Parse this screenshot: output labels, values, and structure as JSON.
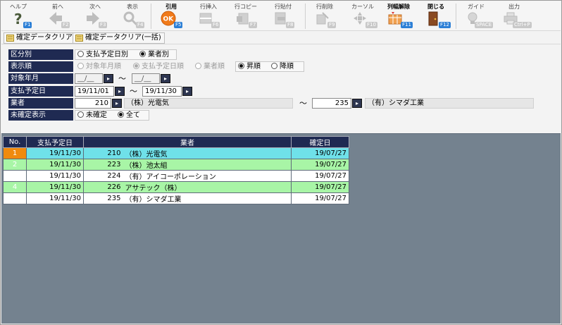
{
  "toolbar": {
    "buttons": [
      {
        "label": "ヘルプ",
        "fkey": "F1",
        "icon": "help-icon"
      },
      {
        "label": "前へ",
        "fkey": "F2",
        "icon": "arrow-left-icon"
      },
      {
        "label": "次へ",
        "fkey": "F3",
        "icon": "arrow-right-icon"
      },
      {
        "label": "表示",
        "fkey": "F4",
        "icon": "magnifier-icon"
      },
      {
        "label": "引用",
        "fkey": "F5",
        "icon": "ok-icon"
      },
      {
        "label": "行挿入",
        "fkey": "F6",
        "icon": "row-insert-icon"
      },
      {
        "label": "行コピー",
        "fkey": "F7",
        "icon": "row-copy-icon"
      },
      {
        "label": "行貼付",
        "fkey": "F8",
        "icon": "row-paste-icon"
      },
      {
        "label": "行削除",
        "fkey": "F9",
        "icon": "row-delete-icon"
      },
      {
        "label": "カーソル",
        "fkey": "F10",
        "icon": "cursor-icon"
      },
      {
        "label": "列幅解除",
        "fkey": "F11",
        "icon": "column-width-reset-icon"
      },
      {
        "label": "閉じる",
        "fkey": "F12",
        "icon": "close-door-icon"
      },
      {
        "label": "ガイド",
        "fkey": "SPACE",
        "icon": "guide-bulb-icon"
      },
      {
        "label": "出力",
        "fkey": "Ctrl+P",
        "icon": "print-icon"
      }
    ]
  },
  "clear_buttons": {
    "clear": "確定データクリア",
    "clear_all": "確定データクリア(一括)"
  },
  "form": {
    "kubun": {
      "label": "区分別",
      "options": [
        "支払予定日別",
        "業者別"
      ],
      "selected": "業者別"
    },
    "order": {
      "label": "表示順",
      "options": [
        "対象年月順",
        "支払予定日順",
        "業者順"
      ],
      "selected": "支払予定日順",
      "direction_options": [
        "昇順",
        "降順"
      ],
      "direction_selected": "昇順"
    },
    "target_month": {
      "label": "対象年月",
      "from": "__/__",
      "to": "__/__"
    },
    "pay_date": {
      "label": "支払予定日",
      "from": "19/11/01",
      "to": "19/11/30"
    },
    "vendor": {
      "label": "業者",
      "from_code": "210",
      "from_name": "（株）光電気",
      "to_code": "235",
      "to_name": "（有）シマダ工業"
    },
    "unconfirmed": {
      "label": "未確定表示",
      "options": [
        "未確定",
        "全て"
      ],
      "selected": "全て"
    },
    "tilde": "～",
    "pick_glyph": "▸"
  },
  "grid": {
    "columns": [
      "No.",
      "支払予定日",
      "業者",
      "確定日"
    ],
    "rows": [
      {
        "no": "1",
        "pay_date": "19/11/30",
        "vendor_code": "210",
        "vendor_name": "（株）光電気",
        "confirmed": "19/07/27"
      },
      {
        "no": "2",
        "pay_date": "19/11/30",
        "vendor_code": "223",
        "vendor_name": "（株）池太組",
        "confirmed": "19/07/27"
      },
      {
        "no": "3",
        "pay_date": "19/11/30",
        "vendor_code": "224",
        "vendor_name": "（有）アイコーポレーション",
        "confirmed": "19/07/27"
      },
      {
        "no": "4",
        "pay_date": "19/11/30",
        "vendor_code": "226",
        "vendor_name": "アサテック（株）",
        "confirmed": "19/07/27"
      },
      {
        "no": "5",
        "pay_date": "19/11/30",
        "vendor_code": "235",
        "vendor_name": "（有）シマダ工業",
        "confirmed": "19/07/27"
      }
    ],
    "row_colors": {
      "current": "#6fe1e9",
      "even": "#a8f5a6",
      "odd": "#ffffff",
      "current_marker": "#f08a0e"
    }
  }
}
